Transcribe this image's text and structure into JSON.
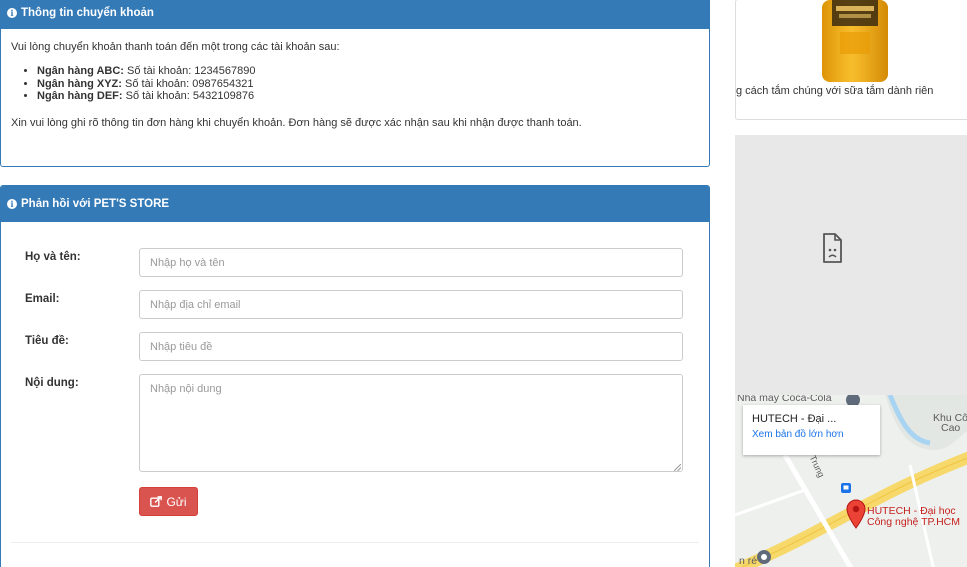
{
  "transfer_panel": {
    "title": "Thông tin chuyển khoản",
    "intro": "Vui lòng chuyển khoản thanh toán đến một trong các tài khoản sau:",
    "banks": [
      {
        "name": "Ngân hàng ABC:",
        "account": " Số tài khoản: 1234567890"
      },
      {
        "name": "Ngân hàng XYZ:",
        "account": " Số tài khoản: 0987654321"
      },
      {
        "name": "Ngân hàng DEF:",
        "account": " Số tài khoản: 5432109876"
      }
    ],
    "note": "Xin vui lòng ghi rõ thông tin đơn hàng khi chuyển khoản. Đơn hàng sẽ được xác nhận sau khi nhận được thanh toán."
  },
  "feedback_panel": {
    "title": "Phản hồi với PET'S STORE",
    "fields": {
      "name": {
        "label": "Họ và tên:",
        "placeholder": "Nhập họ và tên",
        "value": ""
      },
      "email": {
        "label": "Email:",
        "placeholder": "Nhập địa chỉ email",
        "value": ""
      },
      "subject": {
        "label": "Tiêu đề:",
        "placeholder": "Nhập tiêu đề",
        "value": ""
      },
      "content": {
        "label": "Nội dung:",
        "placeholder": "Nhập nội dung",
        "value": ""
      }
    },
    "submit_label": "Gửi"
  },
  "sidebar": {
    "product_caption": "g cách tắm chúng với sữa tắm dành riên",
    "map": {
      "place_card_title": "HUTECH - Đại ...",
      "place_card_link": "Xem bản đồ lớn hơn",
      "labels": {
        "factory": "Nhà máy Coca-Cola",
        "khu_cong": "Khu Côn",
        "cao": "Cao",
        "street": "Trung",
        "hutech_line1": "HUTECH - Đại học",
        "hutech_line2": "Công nghệ TP.HCM",
        "bottom_left": "n ré"
      }
    }
  },
  "colors": {
    "panel_primary": "#337ab7",
    "button_danger": "#d9534f",
    "map_marker": "#ea4335",
    "map_road": "#f6d86b",
    "map_water": "#a8d4f2",
    "map_link": "#1a73e8"
  }
}
